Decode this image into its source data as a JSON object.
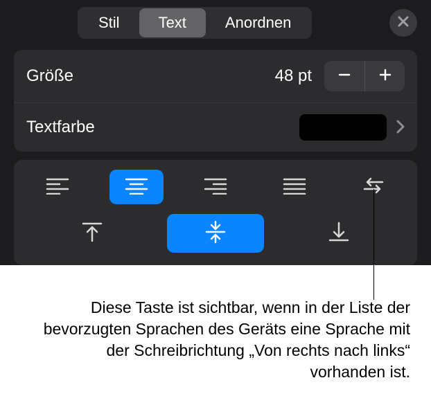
{
  "header": {
    "tabs": [
      {
        "label": "Stil"
      },
      {
        "label": "Text"
      },
      {
        "label": "Anordnen"
      }
    ],
    "active_tab_index": 1
  },
  "rows": {
    "size": {
      "label": "Größe",
      "value": "48 pt"
    },
    "textcolor": {
      "label": "Textfarbe",
      "swatch_hex": "#000000"
    }
  },
  "alignment": {
    "active_h_index": 1,
    "active_v_index": 1
  },
  "caption": "Diese Taste ist sichtbar, wenn in der Liste der bevorzugten Sprachen des Geräts eine Sprache mit der Schreibrichtung „Von rechts nach links“ vorhanden ist."
}
